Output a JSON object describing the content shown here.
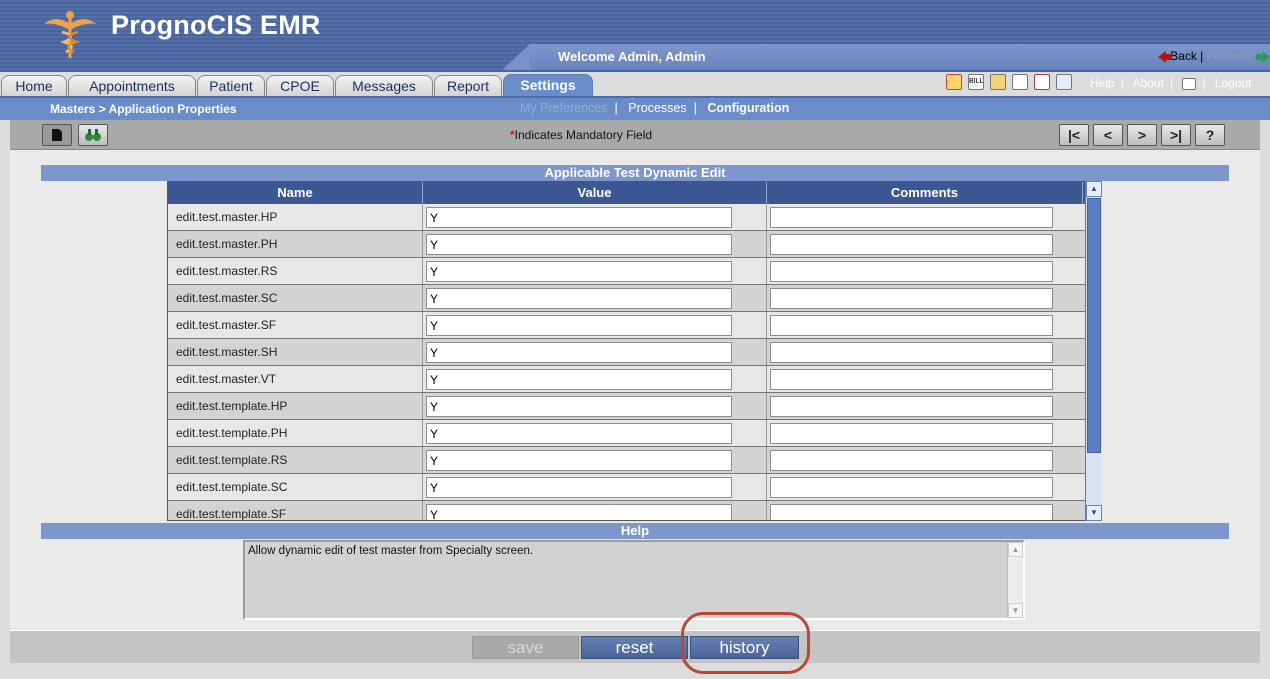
{
  "app": {
    "title": "PrognoCIS EMR",
    "welcome": "Welcome Admin, Admin",
    "back": "Back",
    "forward": "Forward",
    "sep": "|"
  },
  "tabs": [
    {
      "label": "Home"
    },
    {
      "label": "Appointments"
    },
    {
      "label": "Patient"
    },
    {
      "label": "CPOE"
    },
    {
      "label": "Messages"
    },
    {
      "label": "Report"
    },
    {
      "label": "Settings",
      "active": true
    }
  ],
  "top_links": {
    "help": "Help",
    "about": "About",
    "logout": "Logout"
  },
  "top_icons": [
    "alarm-icon",
    "bill-icon",
    "users-icon",
    "person-icon",
    "mail-icon",
    "search-doc-icon"
  ],
  "bill_label": "BILL",
  "breadcrumb": "Masters > Application Properties",
  "subnav": {
    "my_preferences": "My Preferences",
    "processes": "Processes",
    "configuration": "Configuration"
  },
  "toolbar": {
    "mandatory_star": "*",
    "mandatory_note": "Indicates Mandatory Field",
    "nav_first": "|<",
    "nav_prev": "<",
    "nav_next": ">",
    "nav_last": ">|",
    "nav_help": "?"
  },
  "section_title": "Applicable Test Dynamic Edit",
  "grid": {
    "columns": [
      "Name",
      "Value",
      "Comments"
    ],
    "rows": [
      {
        "name": "edit.test.master.HP",
        "value": "Y",
        "comment": ""
      },
      {
        "name": "edit.test.master.PH",
        "value": "Y",
        "comment": ""
      },
      {
        "name": "edit.test.master.RS",
        "value": "Y",
        "comment": ""
      },
      {
        "name": "edit.test.master.SC",
        "value": "Y",
        "comment": ""
      },
      {
        "name": "edit.test.master.SF",
        "value": "Y",
        "comment": ""
      },
      {
        "name": "edit.test.master.SH",
        "value": "Y",
        "comment": ""
      },
      {
        "name": "edit.test.master.VT",
        "value": "Y",
        "comment": ""
      },
      {
        "name": "edit.test.template.HP",
        "value": "Y",
        "comment": ""
      },
      {
        "name": "edit.test.template.PH",
        "value": "Y",
        "comment": ""
      },
      {
        "name": "edit.test.template.RS",
        "value": "Y",
        "comment": ""
      },
      {
        "name": "edit.test.template.SC",
        "value": "Y",
        "comment": ""
      },
      {
        "name": "edit.test.template.SF",
        "value": "Y",
        "comment": ""
      }
    ]
  },
  "help": {
    "title": "Help",
    "text": "Allow dynamic edit of test master from Specialty screen."
  },
  "buttons": {
    "save": "save",
    "reset": "reset",
    "history": "history"
  },
  "colors": {
    "header_blue": "#5570a8",
    "accent_blue": "#6a8dc9",
    "grid_header": "#3b5895",
    "highlight_ring": "#b8473c"
  }
}
